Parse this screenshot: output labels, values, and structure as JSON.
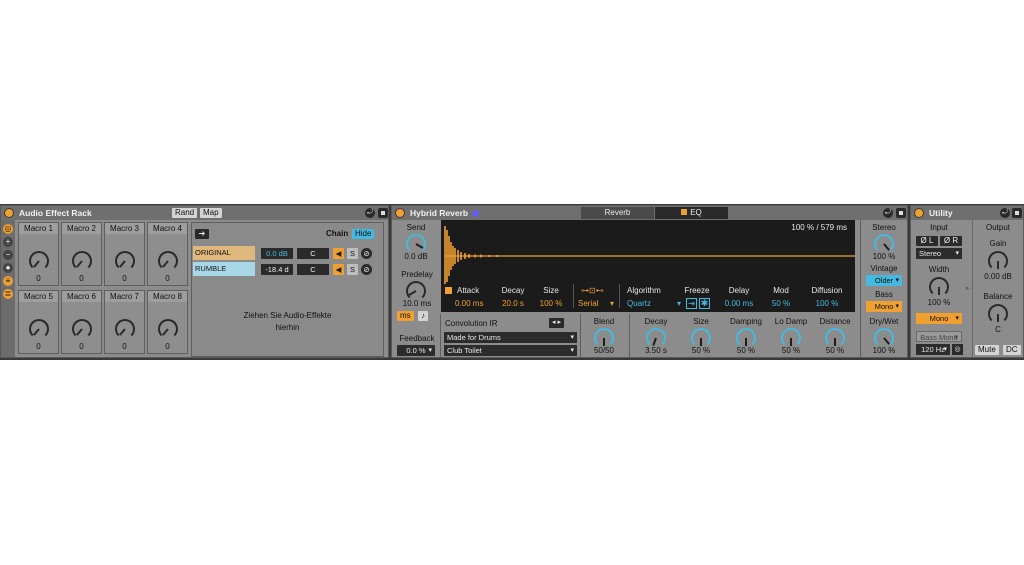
{
  "rack": {
    "title": "Audio Effect Rack",
    "rand": "Rand",
    "map": "Map",
    "macros": [
      {
        "label": "Macro 1",
        "value": "0"
      },
      {
        "label": "Macro 2",
        "value": "0"
      },
      {
        "label": "Macro 3",
        "value": "0"
      },
      {
        "label": "Macro 4",
        "value": "0"
      },
      {
        "label": "Macro 5",
        "value": "0"
      },
      {
        "label": "Macro 6",
        "value": "0"
      },
      {
        "label": "Macro 7",
        "value": "0"
      },
      {
        "label": "Macro 8",
        "value": "0"
      }
    ],
    "chain_button": "Chain",
    "hide_button": "Hide",
    "chains": [
      {
        "name": "ORIGINAL",
        "vol": "0.0 dB",
        "pan": "C",
        "s": "S"
      },
      {
        "name": "RUMBLE",
        "vol": "-18.4 d",
        "pan": "C",
        "s": "S"
      }
    ],
    "drop_hint_1": "Ziehen Sie Audio-Effekte",
    "drop_hint_2": "hierhin"
  },
  "reverb": {
    "title": "Hybrid Reverb",
    "tab_reverb": "Reverb",
    "tab_eq": "EQ",
    "send_label": "Send",
    "send_value": "0.0 dB",
    "predelay_label": "Predelay",
    "predelay_value": "10.0 ms",
    "ms_btn": "ms",
    "note_btn": "♪",
    "feedback_label": "Feedback",
    "feedback_value": "0.0 %",
    "display_readout": "100 % / 579 ms",
    "attack_label": "Attack",
    "attack_value": "0.00 ms",
    "decay_label": "Decay",
    "decay_value": "20.0 s",
    "size_label": "Size",
    "size_value": "100 %",
    "routing_value": "Serial",
    "algorithm_label": "Algorithm",
    "algorithm_value": "Quartz",
    "freeze_label": "Freeze",
    "delay_label": "Delay",
    "delay_value": "0.00 ms",
    "mod_label": "Mod",
    "mod_value": "50 %",
    "diffusion_label": "Diffusion",
    "diffusion_value": "100 %",
    "conv_label": "Convolution IR",
    "ir_category": "Made for Drums",
    "ir_name": "Club Toilet",
    "blend_label": "Blend",
    "blend_value": "50/50",
    "algo_decay_label": "Decay",
    "algo_decay_value": "3.50 s",
    "algo_size_label": "Size",
    "algo_size_value": "50 %",
    "damping_label": "Damping",
    "damping_value": "50 %",
    "lodamp_label": "Lo Damp",
    "lodamp_value": "50 %",
    "distance_label": "Distance",
    "distance_value": "50 %",
    "stereo_label": "Stereo",
    "stereo_value": "100 %",
    "vintage_label": "Vintage",
    "vintage_value": "Older",
    "bass_label": "Bass",
    "bass_value": "Mono",
    "drywet_label": "Dry/Wet",
    "drywet_value": "100 %"
  },
  "utility": {
    "title": "Utility",
    "input_label": "Input",
    "phase_l": "Ø L",
    "phase_r": "Ø R",
    "channel_mode": "Stereo",
    "width_label": "Width",
    "width_value": "100 %",
    "mono_btn": "Mono",
    "bass_mono_btn": "Bass Mono",
    "bass_freq": "120 Hz",
    "output_label": "Output",
    "gain_label": "Gain",
    "gain_value": "0.00 dB",
    "balance_label": "Balance",
    "balance_value": "C",
    "mute_btn": "Mute",
    "dc_btn": "DC"
  },
  "colors": {
    "accent_orange": "#f0a030",
    "accent_blue": "#46b9e0",
    "panel": "#8c8c8c",
    "display_bg": "#1b1b1b"
  }
}
